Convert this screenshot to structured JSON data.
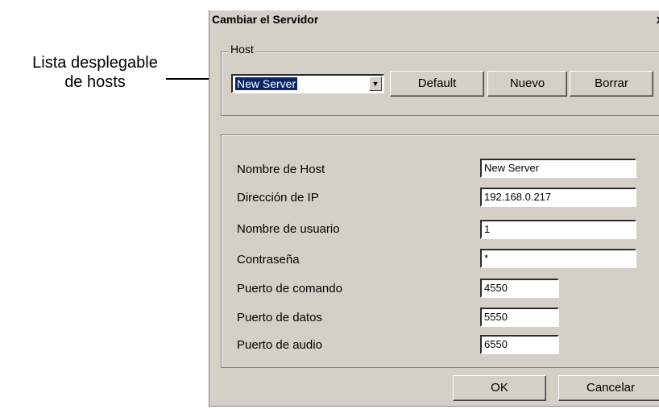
{
  "callout": {
    "line1": "Lista desplegable",
    "line2": "de hosts"
  },
  "dialog": {
    "title": "Cambiar el Servidor",
    "close_label": "x"
  },
  "host_group": {
    "label": "Host",
    "selected_host": "New Server",
    "buttons": {
      "default": "Default",
      "new": "Nuevo",
      "delete": "Borrar"
    }
  },
  "fields": {
    "host_name": {
      "label": "Nombre de Host",
      "value": "New Server"
    },
    "ip_address": {
      "label": "Dirección de IP",
      "value": "192.168.0.217"
    },
    "username": {
      "label": "Nombre de usuario",
      "value": "1"
    },
    "password": {
      "label": "Contraseña",
      "value": "*"
    },
    "command_port": {
      "label": "Puerto de comando",
      "value": "4550"
    },
    "data_port": {
      "label": "Puerto de datos",
      "value": "5550"
    },
    "audio_port": {
      "label": "Puerto de audio",
      "value": "6550"
    }
  },
  "footer": {
    "ok": "OK",
    "cancel": "Cancelar"
  }
}
